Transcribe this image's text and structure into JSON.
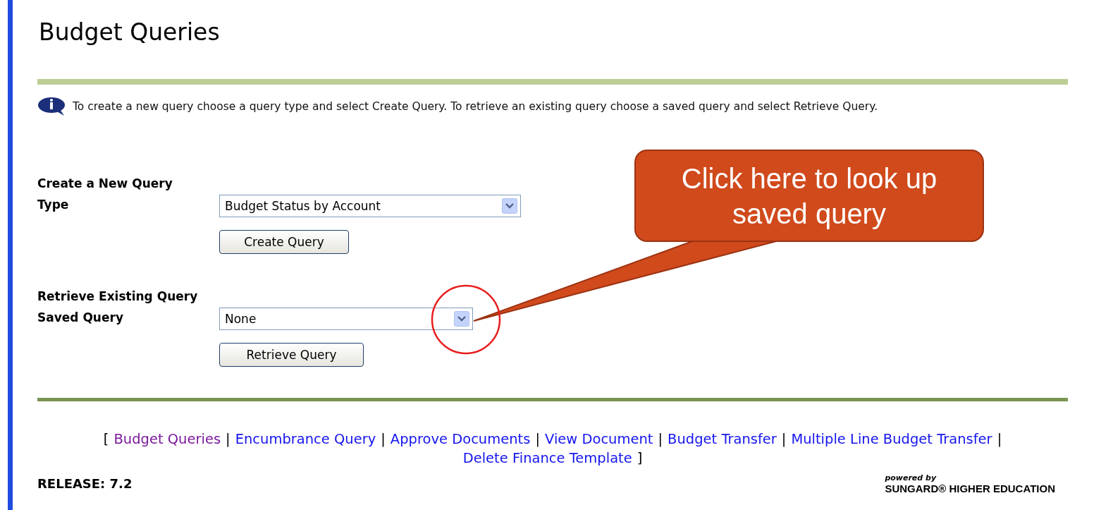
{
  "page_title": "Budget Queries",
  "info": "To create a new query choose a query type and select Create Query. To retrieve an existing query choose a saved query and select Retrieve Query.",
  "sections": [
    {
      "heading": "Create a New Query",
      "field_label": "Type",
      "value": "Budget Status by Account",
      "button": "Create Query"
    },
    {
      "heading": "Retrieve Existing Query",
      "field_label": "Saved Query",
      "value": "None",
      "button": "Retrieve Query"
    }
  ],
  "callout": "Click here to look up saved query",
  "footer": {
    "open_bracket": "[",
    "separator": "|",
    "close_bracket": "]",
    "links": [
      {
        "label": "Budget Queries",
        "visited": true
      },
      {
        "label": "Encumbrance Query",
        "visited": false
      },
      {
        "label": "Approve Documents",
        "visited": false
      },
      {
        "label": "View Document",
        "visited": false
      },
      {
        "label": "Budget Transfer",
        "visited": false
      },
      {
        "label": "Multiple Line Budget Transfer",
        "visited": false
      },
      {
        "label": "Delete Finance Template",
        "visited": false
      }
    ]
  },
  "release": "RELEASE: 7.2",
  "logo": {
    "tagline": "powered by",
    "name": "SUNGARD® HIGHER EDUCATION"
  }
}
